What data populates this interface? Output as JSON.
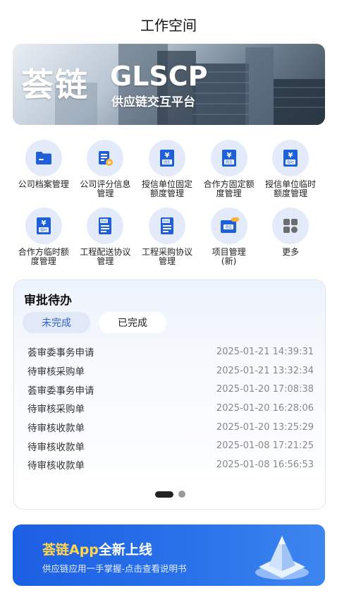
{
  "page": {
    "title": "工作空间"
  },
  "banner": {
    "brand": "荟链",
    "english": "GLSCP",
    "subtitle": "供应链交互平台"
  },
  "grid": {
    "items": [
      {
        "label_lines": [
          "公司档案管理"
        ],
        "icon": "folder-icon"
      },
      {
        "label_lines": [
          "公司评分信息",
          "管理"
        ],
        "icon": "score-document-icon"
      },
      {
        "label_lines": [
          "授信单位固定",
          "额度管理"
        ],
        "icon": "yuan-fixed-icon",
        "tag": "固定"
      },
      {
        "label_lines": [
          "合作方固定额",
          "度管理"
        ],
        "icon": "yuan-fixed-icon",
        "tag": "固定"
      },
      {
        "label_lines": [
          "授信单位临时",
          "额度管理"
        ],
        "icon": "yuan-temporary-icon",
        "tag": "临时"
      },
      {
        "label_lines": [
          "合作方临时额",
          "度管理"
        ],
        "icon": "yuan-temporary-icon",
        "tag": "临时"
      },
      {
        "label_lines": [
          "工程配送协议",
          "管理"
        ],
        "icon": "agreement-icon",
        "tag": "协议"
      },
      {
        "label_lines": [
          "工程采购协议",
          "管理"
        ],
        "icon": "agreement-icon",
        "tag": "协议"
      },
      {
        "label_lines": [
          "项目管理",
          "(新)"
        ],
        "icon": "project-icon",
        "tag": "项目"
      },
      {
        "label_lines": [
          "更多"
        ],
        "icon": "more-apps-icon"
      }
    ]
  },
  "approvals": {
    "title": "审批待办",
    "tabs": [
      "未完成",
      "已完成"
    ],
    "active_tab": "未完成",
    "rows": [
      {
        "title": "荟审委事务申请",
        "time": "2025-01-21 14:39:31"
      },
      {
        "title": "待审核采购单",
        "time": "2025-01-21 13:32:34"
      },
      {
        "title": "荟审委事务申请",
        "time": "2025-01-20 17:08:38"
      },
      {
        "title": "待审核采购单",
        "time": "2025-01-20 16:28:06"
      },
      {
        "title": "待审核收款单",
        "time": "2025-01-20 13:25:29"
      },
      {
        "title": "待审核收款单",
        "time": "2025-01-08 17:21:25"
      },
      {
        "title": "待审核收款单",
        "time": "2025-01-08 16:56:53"
      }
    ],
    "pagination": {
      "pages": 2,
      "current": 1
    }
  },
  "promo": {
    "title_highlight": "荟链App",
    "title_rest": "全新上线",
    "subtitle": "供应链应用一手掌握-点击查看说明书"
  },
  "colors": {
    "accent": "#2e63c8",
    "icon_bg": "#e3ebfa",
    "icon_blue": "#1f5fd9",
    "promo_highlight": "#ffd54a",
    "promo_bg": "#1d5fe3"
  }
}
